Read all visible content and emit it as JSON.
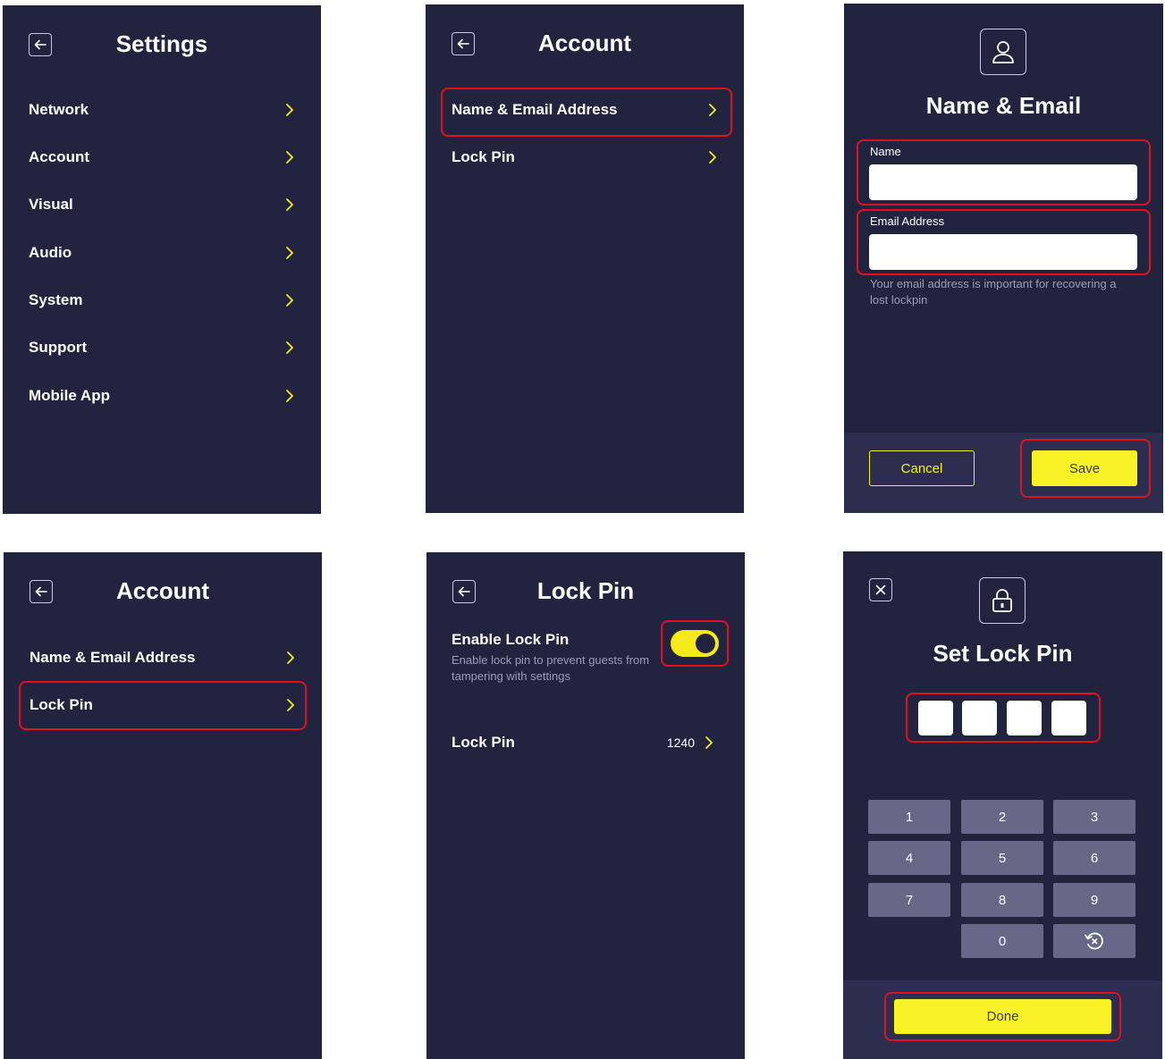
{
  "settings": {
    "title": "Settings",
    "items": [
      {
        "label": "Network"
      },
      {
        "label": "Account"
      },
      {
        "label": "Visual"
      },
      {
        "label": "Audio"
      },
      {
        "label": "System"
      },
      {
        "label": "Support"
      },
      {
        "label": "Mobile App"
      }
    ]
  },
  "account": {
    "title": "Account",
    "items": [
      {
        "label": "Name & Email Address"
      },
      {
        "label": "Lock Pin"
      }
    ]
  },
  "name_email": {
    "title": "Name & Email",
    "name_label": "Name",
    "name_value": "",
    "email_label": "Email Address",
    "email_value": "",
    "helper": "Your email address is important for recovering a lost lockpin",
    "cancel": "Cancel",
    "save": "Save"
  },
  "lock_pin": {
    "title": "Lock Pin",
    "enable_label": "Enable Lock Pin",
    "enable_desc": "Enable lock pin to prevent guests from tampering with settings",
    "enabled": true,
    "pin_label": "Lock Pin",
    "pin_value": "1240"
  },
  "set_pin": {
    "title": "Set Lock Pin",
    "keys": [
      "1",
      "2",
      "3",
      "4",
      "5",
      "6",
      "7",
      "8",
      "9",
      "0"
    ],
    "done": "Done"
  },
  "colors": {
    "background": "#22233f",
    "accent": "#f9f224",
    "highlight": "#e0121d",
    "key": "#666888"
  },
  "icons": {
    "back": "arrow-left-icon",
    "chevron": "chevron-right-icon",
    "user": "user-icon",
    "lock": "lock-icon",
    "close": "close-icon",
    "undo": "undo-icon"
  }
}
